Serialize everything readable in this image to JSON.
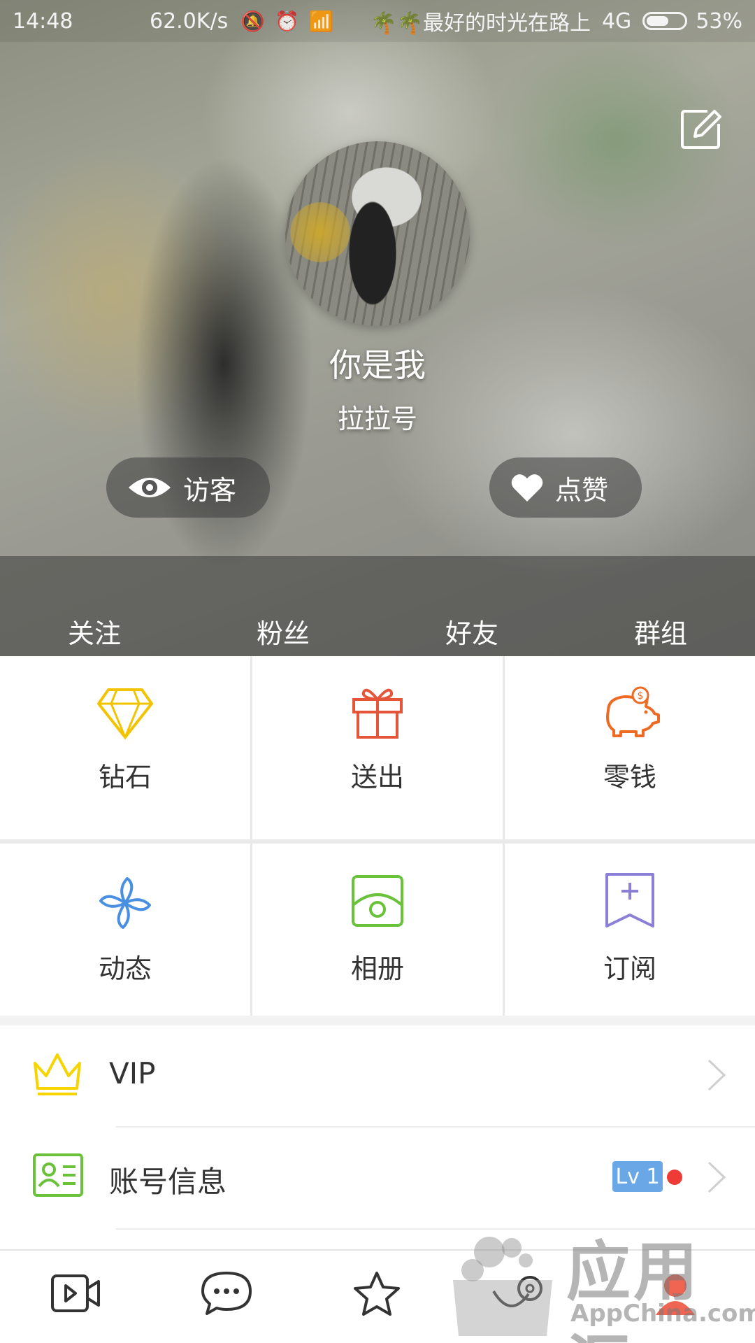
{
  "status_bar": {
    "time": "14:48",
    "net_speed": "62.0K/s",
    "carrier": "🌴🌴最好的时光在路上",
    "network": "4G",
    "battery": "53%",
    "battery_level": 0.53
  },
  "profile": {
    "name": "你是我",
    "id_label": "拉拉号",
    "visitors_label": "访客",
    "likes_label": "点赞"
  },
  "stats": [
    "关注",
    "粉丝",
    "好友",
    "群组"
  ],
  "grid": {
    "diamond": "钻石",
    "sent": "送出",
    "change": "零钱",
    "moments": "动态",
    "album": "相册",
    "subscribe": "订阅"
  },
  "list": {
    "vip": "VIP",
    "account": "账号信息",
    "level_badge": "Lv 1"
  },
  "colors": {
    "diamond": "#f2c400",
    "gift": "#e5553a",
    "piggy": "#ee6a22",
    "moments": "#4a90e2",
    "album": "#6ac23a",
    "subscribe": "#8b7fd8",
    "crown": "#f5d400",
    "card": "#6ac23a",
    "badge": "#6aa7e6"
  },
  "watermark": {
    "text": "应用汇",
    "sub": "AppChina.com"
  }
}
